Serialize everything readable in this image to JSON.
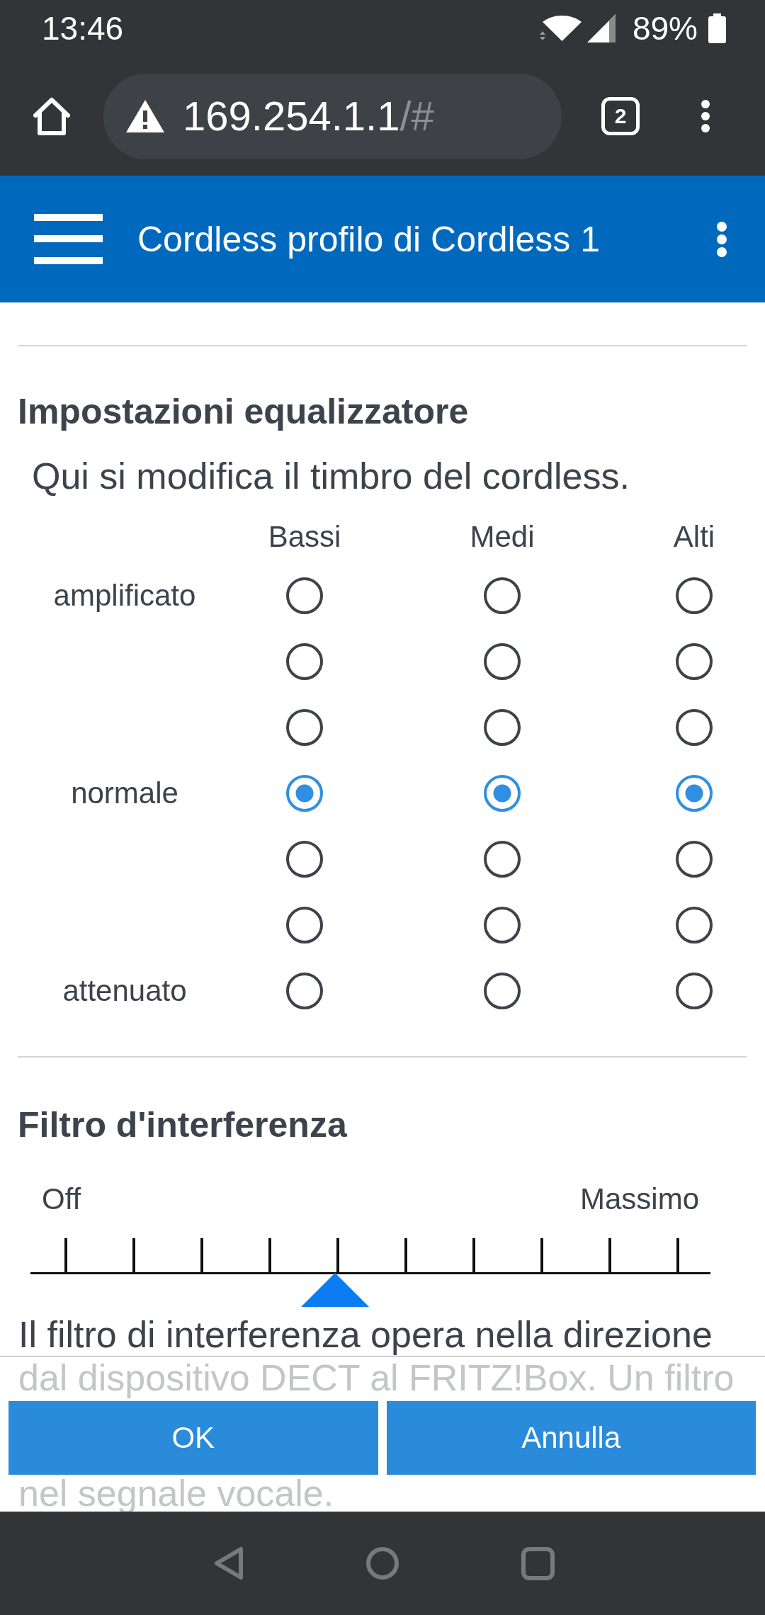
{
  "status_bar": {
    "time": "13:46",
    "battery": "89%"
  },
  "browser": {
    "address": {
      "host": "169.254.1.1",
      "path": "/#"
    },
    "tab_count": "2"
  },
  "app_bar": {
    "title": "Cordless profilo di Cordless 1"
  },
  "equalizer": {
    "title": "Impostazioni equalizzatore",
    "intro": "Qui si modifica il timbro del cordless.",
    "columns": [
      "Bassi",
      "Medi",
      "Alti"
    ],
    "rows": [
      {
        "label": "amplificato",
        "options": [
          {
            "selected": false
          },
          {
            "selected": false
          },
          {
            "selected": false
          }
        ]
      },
      {
        "options": [
          {
            "selected": false
          },
          {
            "selected": false
          },
          {
            "selected": false
          }
        ]
      },
      {
        "options": [
          {
            "selected": false
          },
          {
            "selected": false
          },
          {
            "selected": false
          }
        ]
      },
      {
        "label": "normale",
        "options": [
          {
            "selected": true
          },
          {
            "selected": true
          },
          {
            "selected": true
          }
        ]
      },
      {
        "options": [
          {
            "selected": false
          },
          {
            "selected": false
          },
          {
            "selected": false
          }
        ]
      },
      {
        "options": [
          {
            "selected": false
          },
          {
            "selected": false
          },
          {
            "selected": false
          }
        ]
      },
      {
        "label": "attenuato",
        "options": [
          {
            "selected": false
          },
          {
            "selected": false
          },
          {
            "selected": false
          }
        ]
      }
    ]
  },
  "interference_filter": {
    "title": "Filtro d'interferenza",
    "min_label": "Off",
    "max_label": "Massimo",
    "level": 0.44,
    "description": "Il filtro di interferenza opera nella direzione",
    "covered_text": [
      "dal dispositivo DECT al FRITZ!Box. Un filtro",
      "nel segnale vocale."
    ]
  },
  "footer": {
    "buttons": [
      {
        "label": "OK"
      },
      {
        "label": "Annulla"
      }
    ]
  }
}
